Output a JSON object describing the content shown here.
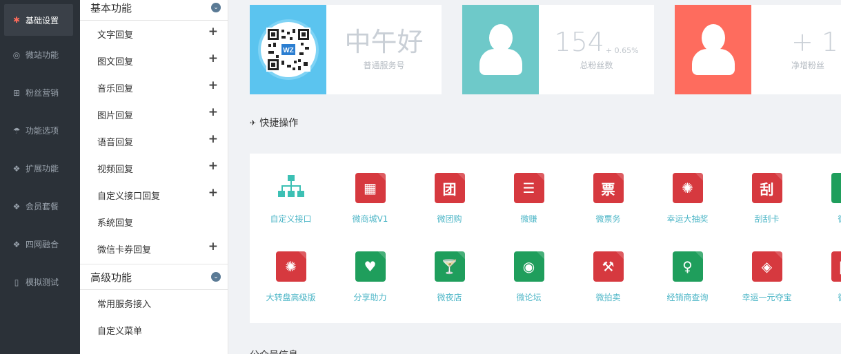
{
  "leftnav": {
    "items": [
      {
        "icon": "gear-icon",
        "glyph": "✱",
        "label": "基础设置",
        "active": true
      },
      {
        "icon": "lifebuoy-icon",
        "glyph": "◎",
        "label": "微站功能"
      },
      {
        "icon": "gift-icon",
        "glyph": "⊞",
        "label": "粉丝营销"
      },
      {
        "icon": "umbrella-icon",
        "glyph": "☂",
        "label": "功能选项"
      },
      {
        "icon": "cubes-icon",
        "glyph": "❖",
        "label": "扩展功能"
      },
      {
        "icon": "cubes-icon",
        "glyph": "❖",
        "label": "会员套餐"
      },
      {
        "icon": "cubes-icon",
        "glyph": "❖",
        "label": "四网融合"
      },
      {
        "icon": "mobile-icon",
        "glyph": "▯",
        "label": "模拟测试"
      }
    ]
  },
  "submenu": {
    "group1": "基本功能",
    "items1": [
      {
        "label": "文字回复",
        "plus": true
      },
      {
        "label": "图文回复",
        "plus": true
      },
      {
        "label": "音乐回复",
        "plus": true
      },
      {
        "label": "图片回复",
        "plus": true
      },
      {
        "label": "语音回复",
        "plus": true
      },
      {
        "label": "视频回复",
        "plus": true
      },
      {
        "label": "自定义接口回复",
        "plus": true
      },
      {
        "label": "系统回复",
        "plus": false
      },
      {
        "label": "微信卡券回复",
        "plus": true
      }
    ],
    "group2": "高级功能",
    "items2": [
      {
        "label": "常用服务接入"
      },
      {
        "label": "自定义菜单"
      }
    ],
    "plus_glyph": "+",
    "chev_glyph": "⌄"
  },
  "stats": {
    "greeting": {
      "big": "中午好",
      "caption": "普通服务号",
      "color": "#5bc4ef"
    },
    "fans": {
      "big": "154",
      "pct": "+ 0.65%",
      "caption": "总粉丝数",
      "color": "#6ec9c9"
    },
    "growth": {
      "big": "+ 1",
      "caption": "净增粉丝",
      "color": "#fe6c5e"
    }
  },
  "quick": {
    "title": "快捷操作",
    "plane_glyph": "✈",
    "row1": [
      {
        "label": "自定义接口",
        "icon": "sitemap-icon",
        "glyph": "",
        "type": "teal"
      },
      {
        "label": "微商城V1",
        "icon": "building-icon",
        "glyph": "▦",
        "type": "red"
      },
      {
        "label": "微团购",
        "icon": "group-buy-icon",
        "glyph": "团",
        "type": "red"
      },
      {
        "label": "微赚",
        "icon": "clipboard-icon",
        "glyph": "☰",
        "type": "red"
      },
      {
        "label": "微票务",
        "icon": "ticket-icon",
        "glyph": "票",
        "type": "red"
      },
      {
        "label": "幸运大抽奖",
        "icon": "wheel-icon",
        "glyph": "✺",
        "type": "red"
      },
      {
        "label": "刮刮卡",
        "icon": "scratch-icon",
        "glyph": "刮",
        "type": "red"
      },
      {
        "label": "微美",
        "icon": "partial-icon",
        "glyph": "",
        "type": "green"
      }
    ],
    "row2": [
      {
        "label": "大转盘高级版",
        "icon": "wheel-icon",
        "glyph": "✺",
        "type": "red"
      },
      {
        "label": "分享助力",
        "icon": "heart-bubble-icon",
        "glyph": "♥",
        "type": "green"
      },
      {
        "label": "微夜店",
        "icon": "cocktail-icon",
        "glyph": "🍸",
        "type": "green"
      },
      {
        "label": "微论坛",
        "icon": "forum-icon",
        "glyph": "◉",
        "type": "green"
      },
      {
        "label": "微拍卖",
        "icon": "gavel-icon",
        "glyph": "⚒",
        "type": "red"
      },
      {
        "label": "经销商查询",
        "icon": "pin-icon",
        "glyph": "♀",
        "type": "green"
      },
      {
        "label": "幸运一元夺宝",
        "icon": "treasure-icon",
        "glyph": "◈",
        "type": "red"
      },
      {
        "label": "微团",
        "icon": "partial-icon",
        "glyph": "团",
        "type": "red"
      }
    ]
  },
  "bottom_partial": "公众号信息"
}
